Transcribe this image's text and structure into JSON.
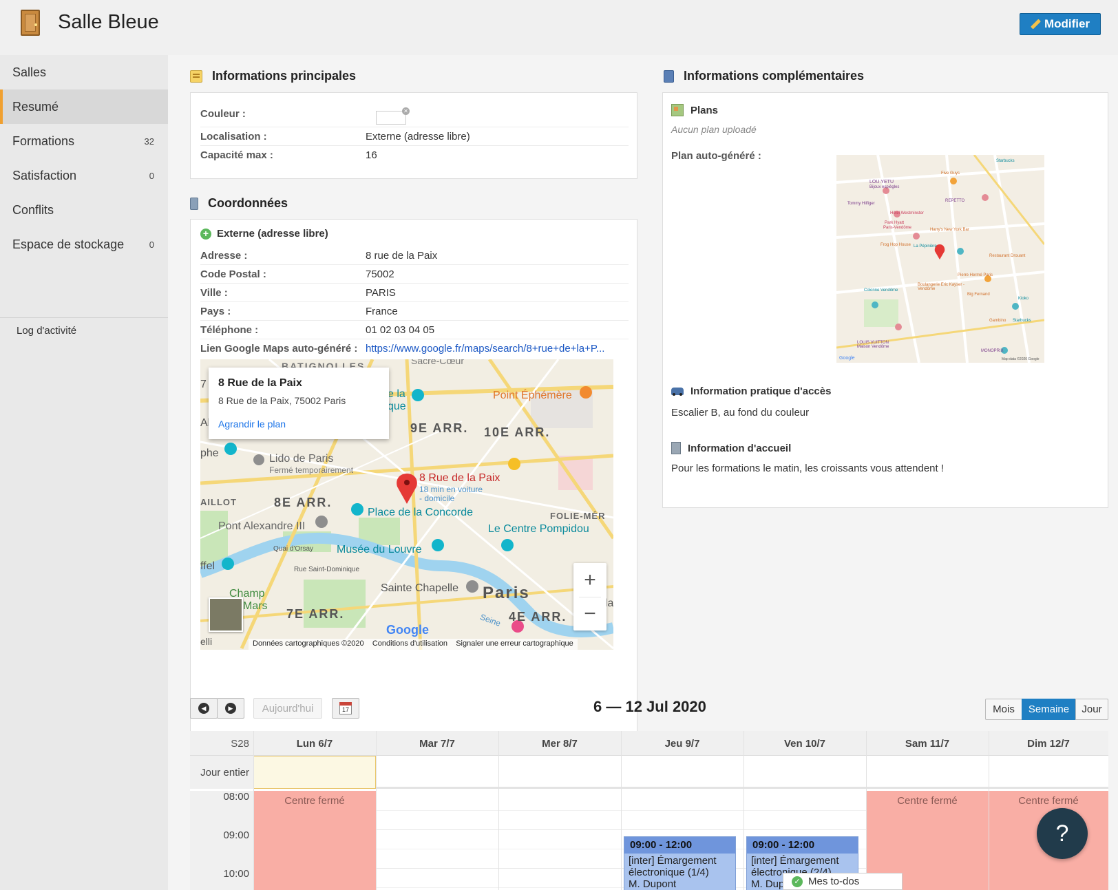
{
  "header": {
    "title": "Salle Bleue",
    "edit_label": "Modifier"
  },
  "sidebar": {
    "items": [
      {
        "label": "Salles",
        "count": ""
      },
      {
        "label": "Resumé",
        "count": ""
      },
      {
        "label": "Formations",
        "count": "32"
      },
      {
        "label": "Satisfaction",
        "count": "0"
      },
      {
        "label": "Conflits",
        "count": ""
      },
      {
        "label": "Espace de stockage",
        "count": "0"
      }
    ],
    "log": "Log d'activité"
  },
  "main_info": {
    "title": "Informations principales",
    "rows": [
      {
        "label": "Couleur :",
        "value": ""
      },
      {
        "label": "Localisation :",
        "value": "Externe (adresse libre)"
      },
      {
        "label": "Capacité max :",
        "value": "16"
      }
    ]
  },
  "coords": {
    "title": "Coordonnées",
    "type": "Externe (adresse libre)",
    "rows": [
      {
        "label": "Adresse :",
        "value": "8 rue de la Paix"
      },
      {
        "label": "Code Postal :",
        "value": "75002"
      },
      {
        "label": "Ville :",
        "value": "PARIS"
      },
      {
        "label": "Pays :",
        "value": "France"
      },
      {
        "label": "Téléphone :",
        "value": "01 02 03 04 05"
      },
      {
        "label": "Lien Google Maps auto-généré :",
        "value": "https://www.google.fr/maps/search/8+rue+de+la+P..."
      }
    ]
  },
  "map": {
    "popup_title": "8 Rue de la Paix",
    "popup_address": "8 Rue de la Paix, 75002 Paris",
    "popup_link": "Agrandir le plan",
    "pin_label": "8 Rue de la Paix",
    "pin_sub1": "18 min en voiture",
    "pin_sub2": "- domicile",
    "zoom_in": "+",
    "zoom_out": "−",
    "footer_data": "Données cartographiques ©2020",
    "footer_terms": "Conditions d'utilisation",
    "footer_report": "Signaler une erreur cartographique",
    "google": "Google",
    "places": [
      "BATIGNOLLES",
      "9E ARR.",
      "10E ARR.",
      "8E ARR.",
      "7E ARR.",
      "4E ARR.",
      "Paris",
      "Point Éphémère",
      "Lido de Paris",
      "Fermé temporairement",
      "Place de la Concorde",
      "Le Centre Pompidou",
      "Pont Alexandre III",
      "Musée du Louvre",
      "Sainte Chapelle",
      "Champ",
      "Mars",
      "FOLIE-MÉR",
      "AILLOT",
      "Quai d'Orsay",
      "Rue Saint-Dominique",
      "Seine",
      "ffel",
      "phe",
      "elli",
      "e la",
      "que",
      "Al",
      "7",
      "la",
      "Sacré-Cœur"
    ]
  },
  "extra_info": {
    "title": "Informations complémentaires",
    "plans_title": "Plans",
    "plans_empty": "Aucun plan uploadé",
    "plan_auto_label": "Plan auto-généré :",
    "access_title": "Information pratique d'accès",
    "access_text": "Escalier B, au fond du couleur",
    "welcome_title": "Information d'accueil",
    "welcome_text": "Pour les formations le matin, les croissants vous attendent !"
  },
  "mini_map": {
    "labels": [
      "LOU.YETU",
      "Bijoux espiègles",
      "Five Guys",
      "Starbucks",
      "Tommy Hilfiger",
      "Hôtel Westminster",
      "REPETTO",
      "Park Hyatt",
      "Paris-Vendôme",
      "Harry's New York Bar",
      "Frog Hop House",
      "La Pépinière",
      "Restaurant Drouant",
      "Pierre Hermé Paris",
      "Boulangerie Eric Kayser - Vendôme",
      "Colonne Vendôme",
      "Big Fernand",
      "Kioko",
      "Gambino",
      "Starbucks",
      "LOUIS VUITTON Maison Vendôme",
      "MONOPRIX",
      "Google",
      "Map data ©2020 Google"
    ]
  },
  "calendar": {
    "prev": "◀",
    "next": "▶",
    "today_label": "Aujourd'hui",
    "cal_icon_day": "17",
    "title": "6 — 12 Jul 2020",
    "views": [
      "Mois",
      "Semaine",
      "Jour"
    ],
    "active_view": "Semaine",
    "week": "S28",
    "days": [
      "Lun 6/7",
      "Mar 7/7",
      "Mer 8/7",
      "Jeu 9/7",
      "Ven 10/7",
      "Sam 11/7",
      "Dim 12/7"
    ],
    "allday_label": "Jour entier",
    "hours": [
      "08:00",
      "09:00",
      "10:00"
    ],
    "closed_label": "Centre fermé",
    "events": [
      {
        "time": "09:00 - 12:00",
        "title": "[inter] Émargement électronique (1/4)",
        "who": "M. Dupont"
      },
      {
        "time": "09:00 - 12:00",
        "title": "[inter] Émargement électronique (2/4)",
        "who": "M. Dupont"
      }
    ]
  },
  "todos": {
    "label": "Mes to-dos"
  },
  "help": {
    "label": "?"
  }
}
